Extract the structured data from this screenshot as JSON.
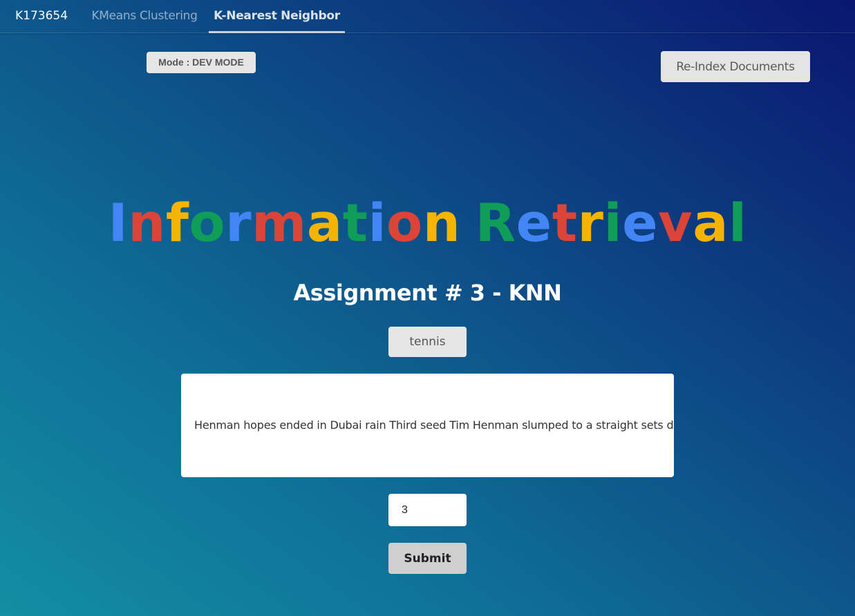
{
  "navbar": {
    "brand": "K173654",
    "tabs": [
      {
        "label": "KMeans Clustering",
        "active": false
      },
      {
        "label": "K-Nearest Neighbor",
        "active": true
      }
    ]
  },
  "mode_badge": "Mode : DEV MODE",
  "reindex_label": "Re-Index Documents",
  "hero": {
    "title": "Information Retrieval",
    "letter_colors": [
      "#4285f4",
      "#db4437",
      "#f4b400",
      "#0f9d58"
    ]
  },
  "subtitle": "Assignment # 3 - KNN",
  "category_label": "tennis",
  "document_text": "Henman hopes ended in Dubai rain  Third seed Tim Henman slumped to a straight sets defeat",
  "k_value": "3",
  "submit_label": "Submit"
}
